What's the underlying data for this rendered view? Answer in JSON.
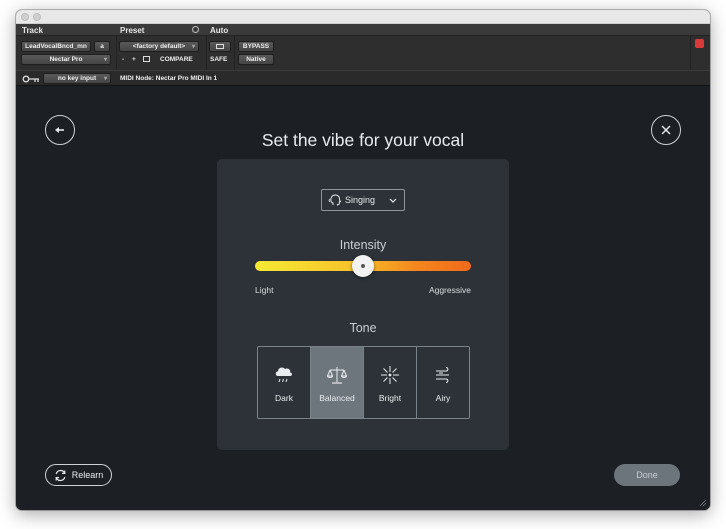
{
  "host": {
    "headers": {
      "track": "Track",
      "preset": "Preset",
      "auto": "Auto"
    },
    "track_name": "LeadVocalBncd_mn",
    "track_slot": "a",
    "plugin_name": "Nectar Pro",
    "preset_name": "<factory default>",
    "preset_minus": "-",
    "preset_plus": "+",
    "compare_label": "COMPARE",
    "bypass_label": "BYPASS",
    "safe_label": "SAFE",
    "native_label": "Native",
    "key_input": "no key input",
    "midi_node": "MIDI Node: Nectar Pro MIDI In 1"
  },
  "plugin": {
    "title": "Set the vibe for your vocal",
    "vocal_style": {
      "selected": "Singing"
    },
    "intensity": {
      "label": "Intensity",
      "value_fraction": 0.5,
      "min_label": "Light",
      "max_label": "Aggressive"
    },
    "tone": {
      "label": "Tone",
      "options": [
        {
          "label": "Dark",
          "icon": "cloud-rain-icon",
          "active": false
        },
        {
          "label": "Balanced",
          "icon": "scale-icon",
          "active": true
        },
        {
          "label": "Bright",
          "icon": "sparkle-icon",
          "active": false
        },
        {
          "label": "Airy",
          "icon": "wind-icon",
          "active": false
        }
      ]
    },
    "relearn_label": "Relearn",
    "done_label": "Done"
  },
  "colors": {
    "background": "#1c2024",
    "panel": "#2c3237",
    "active_tone": "#6e767d",
    "slider_start": "#f6ea35",
    "slider_end": "#f06a1a"
  }
}
